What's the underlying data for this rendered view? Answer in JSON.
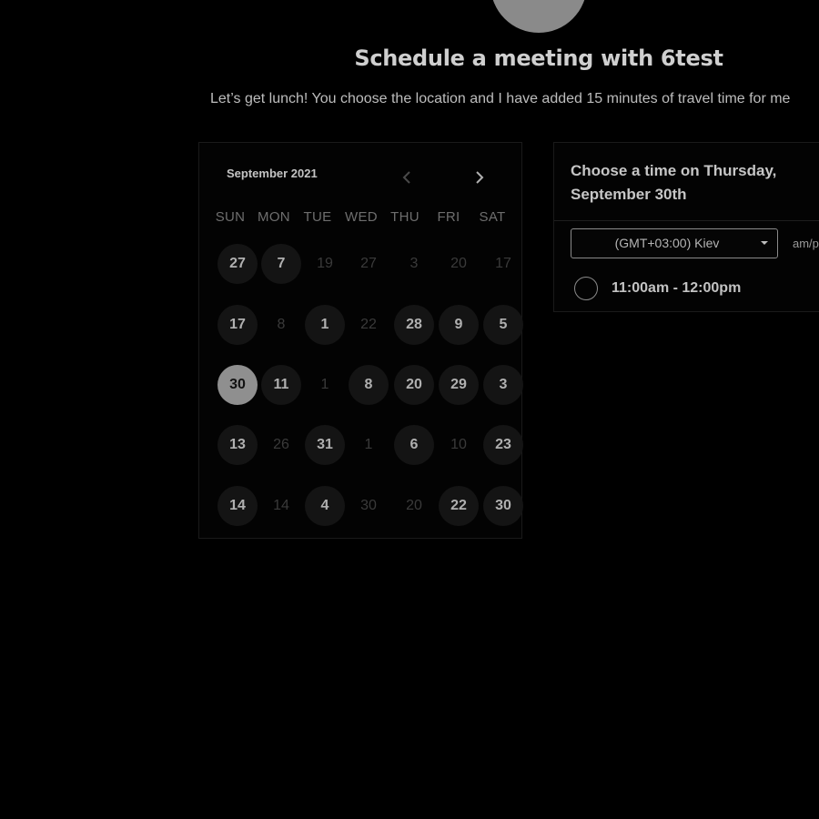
{
  "header": {
    "title": "Schedule a meeting with 6test",
    "subtitle": "Let’s get lunch! You choose the location and I have added 15 minutes of travel time for me"
  },
  "calendar": {
    "month_label": "September 2021",
    "prev_icon": "chevron-left-icon",
    "next_icon": "chevron-right-icon",
    "weekdays": [
      "SUN",
      "MON",
      "TUE",
      "WED",
      "THU",
      "FRI",
      "SAT"
    ],
    "weeks": [
      [
        {
          "label": "27",
          "state": "available"
        },
        {
          "label": "7",
          "state": "available"
        },
        {
          "label": "19",
          "state": "unavailable"
        },
        {
          "label": "27",
          "state": "unavailable"
        },
        {
          "label": "3",
          "state": "unavailable"
        },
        {
          "label": "20",
          "state": "unavailable"
        },
        {
          "label": "17",
          "state": "unavailable"
        }
      ],
      [
        {
          "label": "17",
          "state": "available"
        },
        {
          "label": "8",
          "state": "unavailable"
        },
        {
          "label": "1",
          "state": "available"
        },
        {
          "label": "22",
          "state": "unavailable"
        },
        {
          "label": "28",
          "state": "available"
        },
        {
          "label": "9",
          "state": "available"
        },
        {
          "label": "5",
          "state": "available"
        }
      ],
      [
        {
          "label": "30",
          "state": "selected"
        },
        {
          "label": "11",
          "state": "available"
        },
        {
          "label": "1",
          "state": "unavailable"
        },
        {
          "label": "8",
          "state": "available"
        },
        {
          "label": "20",
          "state": "available"
        },
        {
          "label": "29",
          "state": "available"
        },
        {
          "label": "3",
          "state": "available"
        }
      ],
      [
        {
          "label": "13",
          "state": "available"
        },
        {
          "label": "26",
          "state": "unavailable"
        },
        {
          "label": "31",
          "state": "available"
        },
        {
          "label": "1",
          "state": "unavailable"
        },
        {
          "label": "6",
          "state": "available"
        },
        {
          "label": "10",
          "state": "unavailable"
        },
        {
          "label": "23",
          "state": "available"
        }
      ],
      [
        {
          "label": "14",
          "state": "available"
        },
        {
          "label": "14",
          "state": "unavailable"
        },
        {
          "label": "4",
          "state": "available"
        },
        {
          "label": "30",
          "state": "unavailable"
        },
        {
          "label": "20",
          "state": "unavailable"
        },
        {
          "label": "22",
          "state": "available"
        },
        {
          "label": "30",
          "state": "available"
        }
      ]
    ]
  },
  "time_panel": {
    "heading": "Choose a time on Thursday, September 30th",
    "timezone": {
      "selected": "(GMT+03:00) Kiev",
      "caret_icon": "caret-down-icon"
    },
    "format_toggle": "am/pm",
    "slots": [
      {
        "label": "11:00am - 12:00pm",
        "selected": false
      }
    ]
  },
  "colors": {
    "background": "#000000",
    "selected_day": "#8f8f8f",
    "available_day": "#141414",
    "text": "#c8c8c8"
  }
}
